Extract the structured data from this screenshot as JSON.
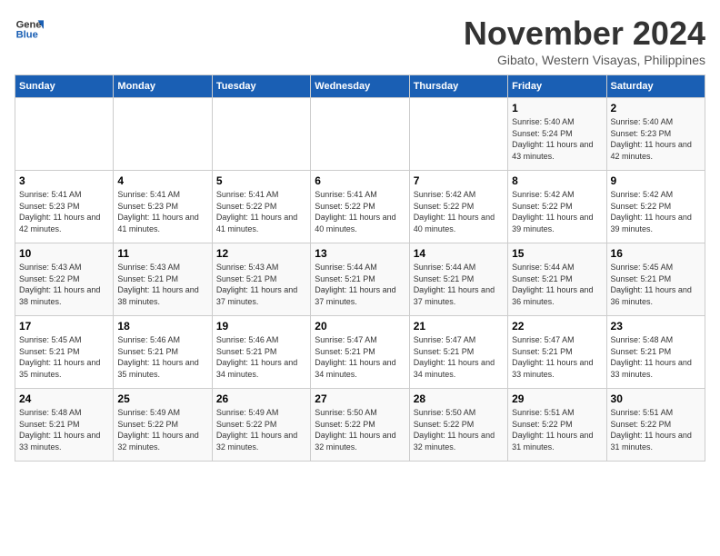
{
  "logo": {
    "line1": "General",
    "line2": "Blue"
  },
  "title": "November 2024",
  "location": "Gibato, Western Visayas, Philippines",
  "weekdays": [
    "Sunday",
    "Monday",
    "Tuesday",
    "Wednesday",
    "Thursday",
    "Friday",
    "Saturday"
  ],
  "weeks": [
    [
      {
        "day": "",
        "info": ""
      },
      {
        "day": "",
        "info": ""
      },
      {
        "day": "",
        "info": ""
      },
      {
        "day": "",
        "info": ""
      },
      {
        "day": "",
        "info": ""
      },
      {
        "day": "1",
        "info": "Sunrise: 5:40 AM\nSunset: 5:24 PM\nDaylight: 11 hours and 43 minutes."
      },
      {
        "day": "2",
        "info": "Sunrise: 5:40 AM\nSunset: 5:23 PM\nDaylight: 11 hours and 42 minutes."
      }
    ],
    [
      {
        "day": "3",
        "info": "Sunrise: 5:41 AM\nSunset: 5:23 PM\nDaylight: 11 hours and 42 minutes."
      },
      {
        "day": "4",
        "info": "Sunrise: 5:41 AM\nSunset: 5:23 PM\nDaylight: 11 hours and 41 minutes."
      },
      {
        "day": "5",
        "info": "Sunrise: 5:41 AM\nSunset: 5:22 PM\nDaylight: 11 hours and 41 minutes."
      },
      {
        "day": "6",
        "info": "Sunrise: 5:41 AM\nSunset: 5:22 PM\nDaylight: 11 hours and 40 minutes."
      },
      {
        "day": "7",
        "info": "Sunrise: 5:42 AM\nSunset: 5:22 PM\nDaylight: 11 hours and 40 minutes."
      },
      {
        "day": "8",
        "info": "Sunrise: 5:42 AM\nSunset: 5:22 PM\nDaylight: 11 hours and 39 minutes."
      },
      {
        "day": "9",
        "info": "Sunrise: 5:42 AM\nSunset: 5:22 PM\nDaylight: 11 hours and 39 minutes."
      }
    ],
    [
      {
        "day": "10",
        "info": "Sunrise: 5:43 AM\nSunset: 5:22 PM\nDaylight: 11 hours and 38 minutes."
      },
      {
        "day": "11",
        "info": "Sunrise: 5:43 AM\nSunset: 5:21 PM\nDaylight: 11 hours and 38 minutes."
      },
      {
        "day": "12",
        "info": "Sunrise: 5:43 AM\nSunset: 5:21 PM\nDaylight: 11 hours and 37 minutes."
      },
      {
        "day": "13",
        "info": "Sunrise: 5:44 AM\nSunset: 5:21 PM\nDaylight: 11 hours and 37 minutes."
      },
      {
        "day": "14",
        "info": "Sunrise: 5:44 AM\nSunset: 5:21 PM\nDaylight: 11 hours and 37 minutes."
      },
      {
        "day": "15",
        "info": "Sunrise: 5:44 AM\nSunset: 5:21 PM\nDaylight: 11 hours and 36 minutes."
      },
      {
        "day": "16",
        "info": "Sunrise: 5:45 AM\nSunset: 5:21 PM\nDaylight: 11 hours and 36 minutes."
      }
    ],
    [
      {
        "day": "17",
        "info": "Sunrise: 5:45 AM\nSunset: 5:21 PM\nDaylight: 11 hours and 35 minutes."
      },
      {
        "day": "18",
        "info": "Sunrise: 5:46 AM\nSunset: 5:21 PM\nDaylight: 11 hours and 35 minutes."
      },
      {
        "day": "19",
        "info": "Sunrise: 5:46 AM\nSunset: 5:21 PM\nDaylight: 11 hours and 34 minutes."
      },
      {
        "day": "20",
        "info": "Sunrise: 5:47 AM\nSunset: 5:21 PM\nDaylight: 11 hours and 34 minutes."
      },
      {
        "day": "21",
        "info": "Sunrise: 5:47 AM\nSunset: 5:21 PM\nDaylight: 11 hours and 34 minutes."
      },
      {
        "day": "22",
        "info": "Sunrise: 5:47 AM\nSunset: 5:21 PM\nDaylight: 11 hours and 33 minutes."
      },
      {
        "day": "23",
        "info": "Sunrise: 5:48 AM\nSunset: 5:21 PM\nDaylight: 11 hours and 33 minutes."
      }
    ],
    [
      {
        "day": "24",
        "info": "Sunrise: 5:48 AM\nSunset: 5:21 PM\nDaylight: 11 hours and 33 minutes."
      },
      {
        "day": "25",
        "info": "Sunrise: 5:49 AM\nSunset: 5:22 PM\nDaylight: 11 hours and 32 minutes."
      },
      {
        "day": "26",
        "info": "Sunrise: 5:49 AM\nSunset: 5:22 PM\nDaylight: 11 hours and 32 minutes."
      },
      {
        "day": "27",
        "info": "Sunrise: 5:50 AM\nSunset: 5:22 PM\nDaylight: 11 hours and 32 minutes."
      },
      {
        "day": "28",
        "info": "Sunrise: 5:50 AM\nSunset: 5:22 PM\nDaylight: 11 hours and 32 minutes."
      },
      {
        "day": "29",
        "info": "Sunrise: 5:51 AM\nSunset: 5:22 PM\nDaylight: 11 hours and 31 minutes."
      },
      {
        "day": "30",
        "info": "Sunrise: 5:51 AM\nSunset: 5:22 PM\nDaylight: 11 hours and 31 minutes."
      }
    ]
  ]
}
